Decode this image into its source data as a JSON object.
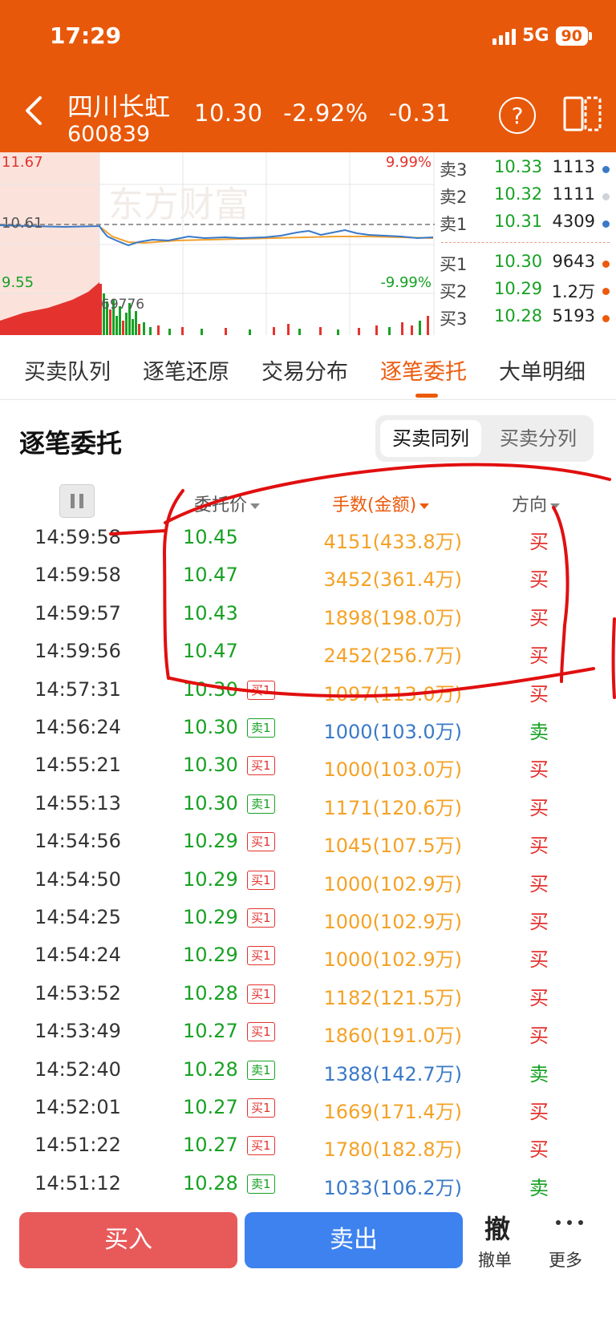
{
  "status": {
    "time": "17:29",
    "network": "5G",
    "battery": "90"
  },
  "header": {
    "name": "四川长虹",
    "code": "600839",
    "price": "10.30",
    "change_pct": "-2.92%",
    "change": "-0.31"
  },
  "chart": {
    "high": "11.67",
    "prev_close": "10.61",
    "low": "9.55",
    "up_limit": "9.99%",
    "down_limit": "-9.99%",
    "volume_label": "69776",
    "watermark": "东方财富"
  },
  "orderbook": [
    {
      "label": "卖3",
      "price": "10.33",
      "vol": "1113",
      "dot": "#3a79c8"
    },
    {
      "label": "卖2",
      "price": "10.32",
      "vol": "1111",
      "dot": "#cfd3d9"
    },
    {
      "label": "卖1",
      "price": "10.31",
      "vol": "4309",
      "dot": "#3a79c8"
    },
    {
      "label": "买1",
      "price": "10.30",
      "vol": "9643",
      "dot": "#ec5a0c"
    },
    {
      "label": "买2",
      "price": "10.29",
      "vol": "1.2万",
      "dot": "#ec5a0c"
    },
    {
      "label": "买3",
      "price": "10.28",
      "vol": "5193",
      "dot": "#ec5a0c"
    }
  ],
  "tabs": [
    "买卖队列",
    "逐笔还原",
    "交易分布",
    "逐笔委托",
    "大单明细"
  ],
  "section": {
    "title": "逐笔委托",
    "seg_left": "买卖同列",
    "seg_right": "买卖分列"
  },
  "table": {
    "col_price": "委托价",
    "col_amount": "手数(金额)",
    "col_dir": "方向",
    "rows": [
      {
        "time": "14:59:58",
        "price": "10.45",
        "badge": "",
        "amount": "4151(433.8万)",
        "dir": "买",
        "side": "buy"
      },
      {
        "time": "14:59:58",
        "price": "10.47",
        "badge": "",
        "amount": "3452(361.4万)",
        "dir": "买",
        "side": "buy"
      },
      {
        "time": "14:59:57",
        "price": "10.43",
        "badge": "",
        "amount": "1898(198.0万)",
        "dir": "买",
        "side": "buy"
      },
      {
        "time": "14:59:56",
        "price": "10.47",
        "badge": "",
        "amount": "2452(256.7万)",
        "dir": "买",
        "side": "buy"
      },
      {
        "time": "14:57:31",
        "price": "10.30",
        "badge": "买1",
        "amount": "1097(113.0万)",
        "dir": "买",
        "side": "buy"
      },
      {
        "time": "14:56:24",
        "price": "10.30",
        "badge": "卖1",
        "amount": "1000(103.0万)",
        "dir": "卖",
        "side": "sell"
      },
      {
        "time": "14:55:21",
        "price": "10.30",
        "badge": "买1",
        "amount": "1000(103.0万)",
        "dir": "买",
        "side": "buy"
      },
      {
        "time": "14:55:13",
        "price": "10.30",
        "badge": "卖1",
        "amount": "1171(120.6万)",
        "dir": "买",
        "side": "buy"
      },
      {
        "time": "14:54:56",
        "price": "10.29",
        "badge": "买1",
        "amount": "1045(107.5万)",
        "dir": "买",
        "side": "buy"
      },
      {
        "time": "14:54:50",
        "price": "10.29",
        "badge": "买1",
        "amount": "1000(102.9万)",
        "dir": "买",
        "side": "buy"
      },
      {
        "time": "14:54:25",
        "price": "10.29",
        "badge": "买1",
        "amount": "1000(102.9万)",
        "dir": "买",
        "side": "buy"
      },
      {
        "time": "14:54:24",
        "price": "10.29",
        "badge": "买1",
        "amount": "1000(102.9万)",
        "dir": "买",
        "side": "buy"
      },
      {
        "time": "14:53:52",
        "price": "10.28",
        "badge": "买1",
        "amount": "1182(121.5万)",
        "dir": "买",
        "side": "buy"
      },
      {
        "time": "14:53:49",
        "price": "10.27",
        "badge": "买1",
        "amount": "1860(191.0万)",
        "dir": "买",
        "side": "buy"
      },
      {
        "time": "14:52:40",
        "price": "10.28",
        "badge": "卖1",
        "amount": "1388(142.7万)",
        "dir": "卖",
        "side": "sell"
      },
      {
        "time": "14:52:01",
        "price": "10.27",
        "badge": "买1",
        "amount": "1669(171.4万)",
        "dir": "买",
        "side": "buy"
      },
      {
        "time": "14:51:22",
        "price": "10.27",
        "badge": "买1",
        "amount": "1780(182.8万)",
        "dir": "买",
        "side": "buy"
      },
      {
        "time": "14:51:12",
        "price": "10.28",
        "badge": "卖1",
        "amount": "1033(106.2万)",
        "dir": "卖",
        "side": "sell"
      }
    ]
  },
  "bottom": {
    "buy": "买入",
    "sell": "卖出",
    "cancel_icon": "撤",
    "cancel": "撤单",
    "more": "更多"
  },
  "colors": {
    "brand": "#e8580a",
    "buy": "#e4332f",
    "sell": "#17a123",
    "amount_buy": "#f4a226",
    "amount_sell": "#3a79c8",
    "annotation": "#e10f0f"
  }
}
